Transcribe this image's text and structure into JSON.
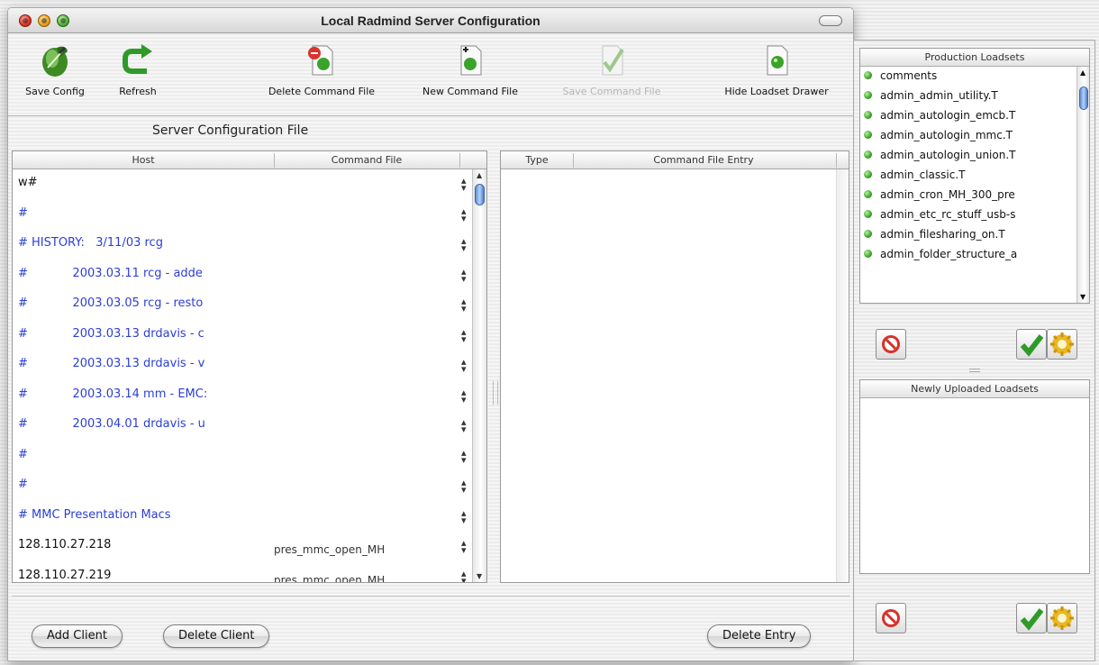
{
  "window": {
    "title": "Local Radmind Server Configuration"
  },
  "toolbar": {
    "save_config": "Save Config",
    "refresh": "Refresh",
    "delete_command_file": "Delete Command File",
    "new_command_file": "New Command File",
    "save_command_file": "Save Command File",
    "hide_loadset_drawer": "Hide Loadset Drawer"
  },
  "section_title": "Server Configuration File",
  "host_table": {
    "headers": [
      "Host",
      "Command File"
    ],
    "rows": [
      {
        "host": "w#",
        "cmd": "",
        "comment": false
      },
      {
        "host": "#",
        "cmd": "",
        "comment": true
      },
      {
        "host": "# HISTORY:   3/11/03 rcg",
        "cmd": "",
        "comment": true
      },
      {
        "host": "#            2003.03.11 rcg - adde",
        "cmd": "",
        "comment": true
      },
      {
        "host": "#            2003.03.05 rcg - resto",
        "cmd": "",
        "comment": true
      },
      {
        "host": "#            2003.03.13 drdavis - c",
        "cmd": "",
        "comment": true
      },
      {
        "host": "#            2003.03.13 drdavis - v",
        "cmd": "",
        "comment": true
      },
      {
        "host": "#            2003.03.14 mm - EMC:",
        "cmd": "",
        "comment": true
      },
      {
        "host": "#            2003.04.01 drdavis - u",
        "cmd": "",
        "comment": true
      },
      {
        "host": "#",
        "cmd": "",
        "comment": true
      },
      {
        "host": "#",
        "cmd": "",
        "comment": true
      },
      {
        "host": "# MMC Presentation Macs",
        "cmd": "",
        "comment": true
      },
      {
        "host": "128.110.27.218",
        "cmd": "pres_mmc_open_MH",
        "comment": false
      },
      {
        "host": "128.110.27.219",
        "cmd": "pres_mmc_open_MH",
        "comment": false
      }
    ]
  },
  "command_table": {
    "headers": [
      "Type",
      "Command File Entry"
    ]
  },
  "buttons": {
    "add_client": "Add Client",
    "delete_client": "Delete Client",
    "delete_entry": "Delete Entry"
  },
  "drawer": {
    "production_title": "Production Loadsets",
    "production_items": [
      "comments",
      "admin_admin_utility.T",
      "admin_autologin_emcb.T",
      "admin_autologin_mmc.T",
      "admin_autologin_union.T",
      "admin_classic.T",
      "admin_cron_MH_300_pre",
      "admin_etc_rc_stuff_usb-s",
      "admin_filesharing_on.T",
      "admin_folder_structure_a"
    ],
    "newly_title": "Newly Uploaded Loadsets"
  },
  "colors": {
    "comment_text": "#2b3fd6",
    "scroll_thumb": "#5d8ed6"
  },
  "icons": {
    "save_config": "leaf-save-icon",
    "refresh": "green-refresh-arrow-icon",
    "delete_command_file": "document-delete-icon",
    "new_command_file": "document-new-icon",
    "save_command_file": "document-save-icon",
    "hide_loadset_drawer": "document-drawer-icon"
  }
}
